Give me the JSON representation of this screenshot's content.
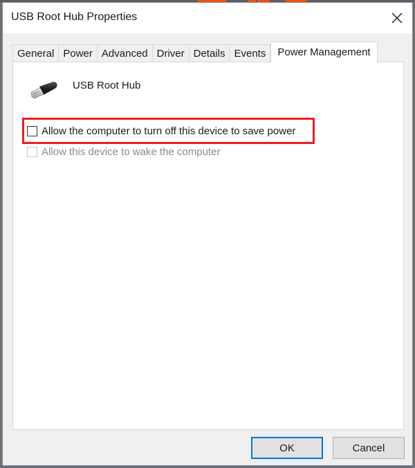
{
  "window": {
    "title": "USB Root Hub Properties",
    "close_icon": "close-icon"
  },
  "tabs": [
    {
      "label": "General",
      "active": false
    },
    {
      "label": "Power",
      "active": false
    },
    {
      "label": "Advanced",
      "active": false
    },
    {
      "label": "Driver",
      "active": false
    },
    {
      "label": "Details",
      "active": false
    },
    {
      "label": "Events",
      "active": false
    },
    {
      "label": "Power Management",
      "active": true
    }
  ],
  "panel": {
    "device_icon": "usb-plug-icon",
    "device_name": "USB Root Hub",
    "options": [
      {
        "label": "Allow the computer to turn off this device to save power",
        "checked": false,
        "enabled": true,
        "highlighted": true
      },
      {
        "label": "Allow this device to wake the computer",
        "checked": false,
        "enabled": false,
        "highlighted": false
      }
    ],
    "highlight_color": "#ee1c25"
  },
  "buttons": {
    "ok_label": "OK",
    "cancel_label": "Cancel"
  },
  "colors": {
    "focus_border": "#0078d7"
  }
}
